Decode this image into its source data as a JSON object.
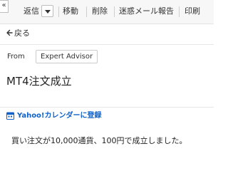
{
  "toolbar": {
    "collapse_glyph": "«",
    "reply_label": "返信",
    "move_label": "移動",
    "delete_label": "削除",
    "spam_label": "迷惑メール報告",
    "print_label": "印刷"
  },
  "nav": {
    "back_label": "戻る"
  },
  "message": {
    "from_label": "From",
    "from_name": "Expert Advisor",
    "subject": "MT4注文成立",
    "calendar_link": "Yahoo!カレンダーに登録",
    "body": "買い注文が10,000通貨、100円で成立しました。"
  },
  "colors": {
    "link": "#0f62c9",
    "toolbar_bg": "#f7f7f7"
  },
  "icons": [
    "chevron-down-icon",
    "back-arrow-icon",
    "calendar-icon"
  ]
}
